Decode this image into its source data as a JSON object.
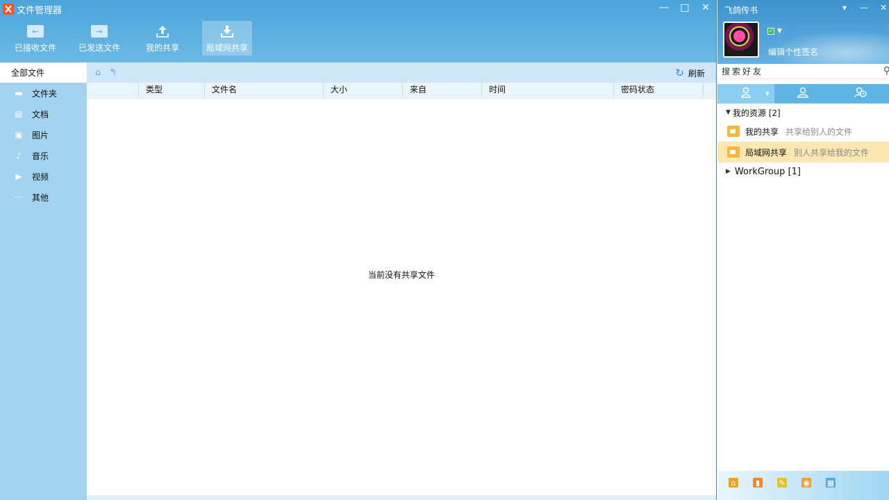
{
  "file_manager": {
    "title": "文件管理器",
    "window_controls": [
      "—",
      "□",
      "✕"
    ],
    "toolbar": [
      {
        "label": "已接收文件",
        "icon": "received-files-icon"
      },
      {
        "label": "已发送文件",
        "icon": "sent-files-icon"
      },
      {
        "label": "我的共享",
        "icon": "upload-share-icon"
      },
      {
        "label": "局域网共享",
        "icon": "download-lan-icon"
      }
    ],
    "sidebar": {
      "header": "全部文件",
      "items": [
        {
          "label": "文件夹",
          "icon": "folder-icon",
          "glyph": "▬"
        },
        {
          "label": "文档",
          "icon": "document-icon",
          "glyph": "▤"
        },
        {
          "label": "图片",
          "icon": "image-icon",
          "glyph": "▣"
        },
        {
          "label": "音乐",
          "icon": "music-icon",
          "glyph": "♪"
        },
        {
          "label": "视频",
          "icon": "video-icon",
          "glyph": "▶"
        },
        {
          "label": "其他",
          "icon": "more-icon",
          "glyph": "···"
        }
      ]
    },
    "nav": {
      "home_glyph": "⌂",
      "up_glyph": "↰",
      "refresh_glyph": "↻",
      "refresh_label": "刷新"
    },
    "columns": [
      "类型",
      "文件名",
      "大小",
      "来自",
      "时间",
      "密码状态"
    ],
    "empty_message": "当前没有共享文件"
  },
  "messenger": {
    "title": "飞鸽传书",
    "window_controls": [
      "▾",
      "—",
      "✕"
    ],
    "status_glyph": "✓",
    "signature": "编辑个性签名",
    "search_label": "搜索好友",
    "search_glyph": "⚲",
    "tabs": [
      {
        "icon": "contact-icon",
        "glyph": "👤"
      },
      {
        "icon": "group-icon",
        "glyph": "👥"
      },
      {
        "icon": "recent-icon",
        "glyph": "◷"
      }
    ],
    "tree": {
      "group_label": "我的资源 [2]",
      "resources": [
        {
          "name": "我的共享",
          "desc": "共享给别人的文件"
        },
        {
          "name": "局域网共享",
          "desc": "别人共享给我的文件"
        }
      ],
      "workgroup_label": "WorkGroup [1]"
    },
    "bottom_icons": [
      {
        "icon": "home-icon",
        "color": "#e9a521"
      },
      {
        "icon": "book-icon",
        "color": "#f0882b"
      },
      {
        "icon": "note-icon",
        "color": "#e3c22a"
      },
      {
        "icon": "photo-icon",
        "color": "#e8a23d"
      },
      {
        "icon": "app-icon",
        "color": "#5aa9d9"
      }
    ]
  }
}
